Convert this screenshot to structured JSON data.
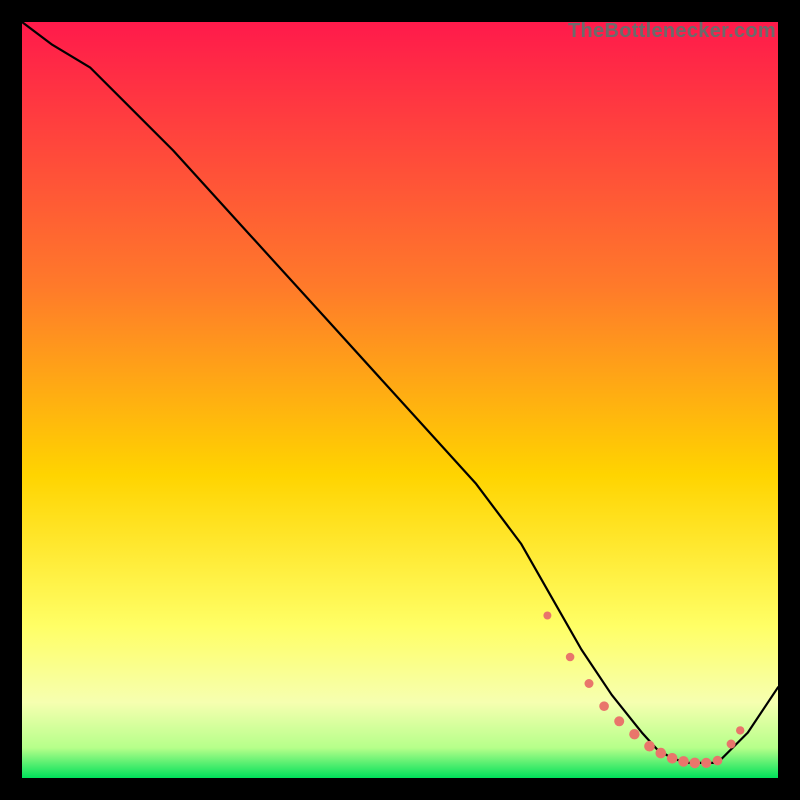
{
  "watermark": "TheBottlenecker.com",
  "colors": {
    "gradient_top": "#ff1a4b",
    "gradient_mid1": "#ff7a2a",
    "gradient_mid2": "#ffd400",
    "gradient_mid3": "#ffff66",
    "gradient_bot": "#00e05a",
    "dot": "#e9756b",
    "line": "#000000"
  },
  "chart_data": {
    "type": "line",
    "title": "",
    "xlabel": "",
    "ylabel": "",
    "xlim": [
      0,
      100
    ],
    "ylim": [
      0,
      100
    ],
    "series": [
      {
        "name": "curve",
        "x": [
          0,
          4,
          9,
          20,
          30,
          40,
          50,
          60,
          66,
          70,
          74,
          78,
          82,
          84,
          86,
          88,
          92,
          96,
          100
        ],
        "y": [
          100,
          97,
          94,
          83,
          72,
          61,
          50,
          39,
          31,
          24,
          17,
          11,
          6,
          3.8,
          2.6,
          2.0,
          2.0,
          6,
          12
        ]
      }
    ],
    "markers": {
      "name": "dots",
      "x": [
        69.5,
        72.5,
        75,
        77,
        79,
        81,
        83,
        84.5,
        86,
        87.5,
        89,
        90.5,
        92,
        93.8,
        95
      ],
      "y": [
        21.5,
        16,
        12.5,
        9.5,
        7.5,
        5.8,
        4.2,
        3.3,
        2.6,
        2.2,
        2.0,
        2.0,
        2.3,
        4.5,
        6.3
      ],
      "r": [
        4,
        4.3,
        4.5,
        4.8,
        5.0,
        5.2,
        5.3,
        5.3,
        5.3,
        5.3,
        5.3,
        5.1,
        4.8,
        4.5,
        4.2
      ]
    }
  }
}
